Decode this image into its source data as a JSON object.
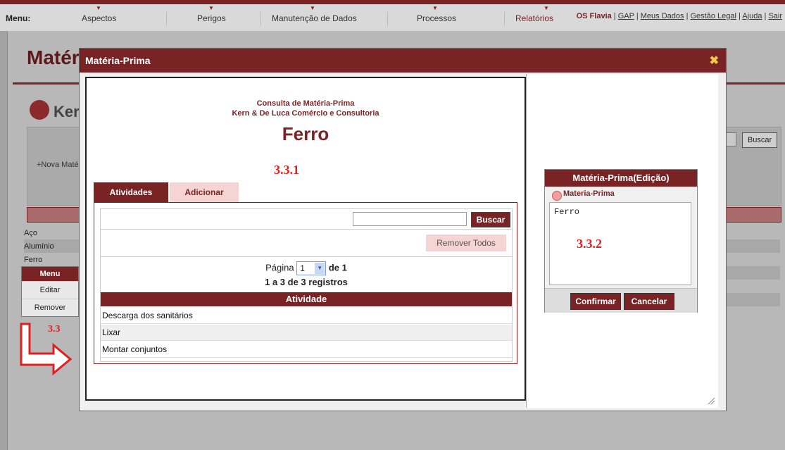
{
  "topmenu": {
    "label": "Menu:",
    "items": [
      "Aspectos",
      "Perigos",
      "Manutenção de Dados",
      "Processos",
      "Relatórios"
    ],
    "user": "OS Flavia",
    "links": [
      "GAP",
      "Meus Dados",
      "Gestão Legal",
      "Ajuda",
      "Sair"
    ]
  },
  "background": {
    "title": "Matéria-Prima",
    "subtitle": "Kern",
    "new_button": "+Nova Matéria-Prima",
    "search_button": "Buscar",
    "list": [
      "Aço",
      "Alumínio",
      "Ferro"
    ]
  },
  "context_menu": {
    "header": "Menu",
    "items": [
      "Editar",
      "Remover"
    ]
  },
  "annotations": {
    "a33": "3.3",
    "a331": "3.3.1",
    "a332": "3.3.2"
  },
  "modal": {
    "title": "Matéria-Prima",
    "close": "✖",
    "heading1": "Consulta de Matéria-Prima",
    "heading2": "Kern & De Luca Comércio e Consultoria",
    "material": "Ferro",
    "tabs": [
      "Atividades",
      "Adicionar"
    ],
    "search_button": "Buscar",
    "remove_all": "Remover Todos",
    "page_label": "Página",
    "page_value": "1",
    "page_suffix": "de 1",
    "records": "1 a 3 de 3 registros",
    "column": "Atividade",
    "rows": [
      "Descarga dos sanitários",
      "Lixar",
      "Montar conjuntos"
    ]
  },
  "edit": {
    "title": "Matéria-Prima(Edição)",
    "radio_label": "Materia-Prima",
    "value": "Ferro",
    "confirm": "Confirmar",
    "cancel": "Cancelar"
  },
  "colors": {
    "primary": "#7a2325",
    "tab_inactive": "#f6d4d4",
    "annotation": "#e02020"
  }
}
